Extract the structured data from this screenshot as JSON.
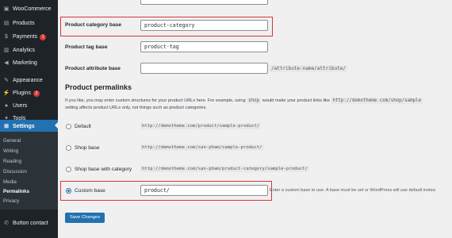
{
  "sidebar": {
    "items": [
      {
        "label": "WooCommerce",
        "icon": "woo-icon"
      },
      {
        "label": "Products",
        "icon": "products-icon"
      },
      {
        "label": "Payments",
        "icon": "payments-icon",
        "badge": "1"
      },
      {
        "label": "Analytics",
        "icon": "analytics-icon"
      },
      {
        "label": "Marketing",
        "icon": "marketing-icon"
      },
      {
        "label": "Appearance",
        "icon": "appearance-icon"
      },
      {
        "label": "Plugins",
        "icon": "plugins-icon",
        "badge": "2"
      },
      {
        "label": "Users",
        "icon": "users-icon"
      },
      {
        "label": "Tools",
        "icon": "tools-icon"
      },
      {
        "label": "Settings",
        "icon": "settings-icon",
        "active": true
      },
      {
        "label": "Button contact",
        "icon": "phone-icon"
      }
    ],
    "submenu": [
      {
        "label": "General"
      },
      {
        "label": "Writing"
      },
      {
        "label": "Reading"
      },
      {
        "label": "Discussion"
      },
      {
        "label": "Media"
      },
      {
        "label": "Permalinks",
        "current": true
      },
      {
        "label": "Privacy"
      }
    ]
  },
  "fields": {
    "category_label": "Product category base",
    "category_value": "product-category",
    "tag_label": "Product tag base",
    "tag_value": "product-tag",
    "attribute_label": "Product attribute base",
    "attribute_value": "",
    "attribute_suffix": "/attribute-name/attribute/"
  },
  "permalinks": {
    "title": "Product permalinks",
    "desc_part1": "If you like, you may enter custom structures for your product URLs here. For example, using",
    "desc_code1": "shop",
    "desc_part2": "would make your product links like",
    "desc_code2": "http://demotheme.com/shop/sample",
    "desc_line2": "setting affects product URLs only, not things such as product categories.",
    "options": [
      {
        "label": "Default",
        "url": "http://demotheme.com/product/sample-product/",
        "selected": false
      },
      {
        "label": "Shop base",
        "url": "http://demotheme.com/san-pham/sample-product/",
        "selected": false
      },
      {
        "label": "Shop base with category",
        "url": "http://demotheme.com/san-pham/product-category/sample-product/",
        "selected": false
      },
      {
        "label": "Custom base",
        "selected": true
      }
    ],
    "custom_value": "product/",
    "custom_hint": "Enter a custom base to use. A base must be set or WordPress will use default instea"
  },
  "save_label": "Save Changes",
  "colors": {
    "sidebar_bg": "#1d2327",
    "accent": "#2271b1",
    "highlight_border": "#d63638",
    "page_bg": "#f0f0f1"
  }
}
